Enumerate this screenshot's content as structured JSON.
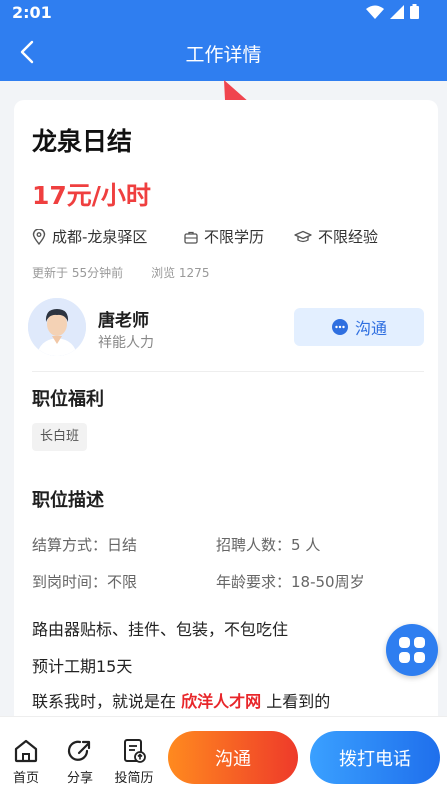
{
  "status_bar": {
    "time": "2:01",
    "icons": [
      "wifi-icon",
      "signal-icon",
      "battery-icon"
    ]
  },
  "nav": {
    "title": "工作详情",
    "back_icon": "back-arrow-icon"
  },
  "job": {
    "title": "龙泉日结",
    "salary": "17元/小时",
    "location": "成都-龙泉驿区",
    "education": "不限学历",
    "experience": "不限经验",
    "updated": "更新于 55分钟前",
    "views": "浏览 1275"
  },
  "recruiter": {
    "name": "唐老师",
    "company": "祥能人力",
    "chat_label": "沟通"
  },
  "benefits": {
    "title": "职位福利",
    "items": [
      "长白班"
    ]
  },
  "description": {
    "title": "职位描述",
    "fields": [
      {
        "label": "结算方式：",
        "value": "日结"
      },
      {
        "label": "招聘人数：",
        "value": "5 人"
      },
      {
        "label": "到岗时间：",
        "value": "不限"
      },
      {
        "label": "年龄要求：",
        "value": "18-50周岁"
      }
    ],
    "lines": [
      "路由器贴标、挂件、包装，不包吃住",
      "预计工期15天"
    ],
    "contact_prefix": "联系我时，就说是在",
    "contact_site": "欣洋人才网",
    "contact_suffix": "上看到的"
  },
  "bottom_bar": {
    "home": "首页",
    "share": "分享",
    "resume": "投简历",
    "chat": "沟通",
    "call": "拨打电话"
  },
  "colors": {
    "primary": "#2f7ef0",
    "salary": "#ef3f3f",
    "chat_gradient": [
      "#ff8a1f",
      "#ee3a2a"
    ],
    "call_gradient": [
      "#3aa0ff",
      "#1f6fec"
    ]
  }
}
